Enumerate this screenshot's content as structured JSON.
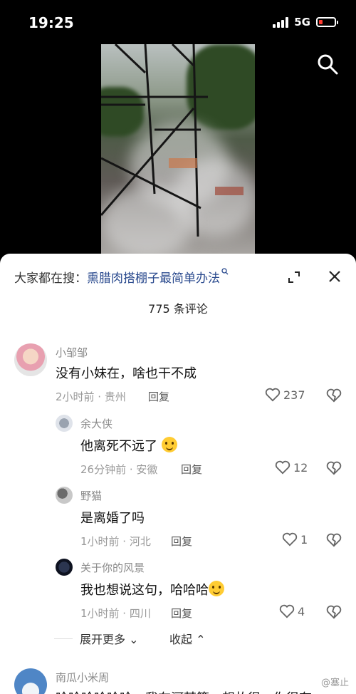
{
  "status": {
    "time": "19:25",
    "network": "5G",
    "battery_color": "#ff3b30"
  },
  "search": {
    "prefix": "大家都在搜：",
    "keyword": "熏腊肉搭棚子最简单办法"
  },
  "comments_count_label": "775 条评论",
  "comments": [
    {
      "user": "小邹邹",
      "text": "没有小妹在，啥也干不成",
      "time_location": "2小时前 · 贵州",
      "reply": "回复",
      "likes": "237"
    },
    {
      "user": "余大侠",
      "text": "他离死不远了",
      "time_location": "26分钟前 · 安徽",
      "reply": "回复",
      "likes": "12"
    },
    {
      "user": "野猫",
      "text": "是离婚了吗",
      "time_location": "1小时前 · 河北",
      "reply": "回复",
      "likes": "1"
    },
    {
      "user": "关于你的风景",
      "text": "我也想说这句，哈哈哈",
      "time_location": "1小时前 · 四川",
      "reply": "回复",
      "likes": "4"
    },
    {
      "user": "南瓜小米周",
      "text": "哈哈哈哈哈哈，我在河某策，想故很，你很有"
    }
  ],
  "actions": {
    "expand_more": "展开更多",
    "collapse": "收起"
  },
  "watermark": "@塞止"
}
